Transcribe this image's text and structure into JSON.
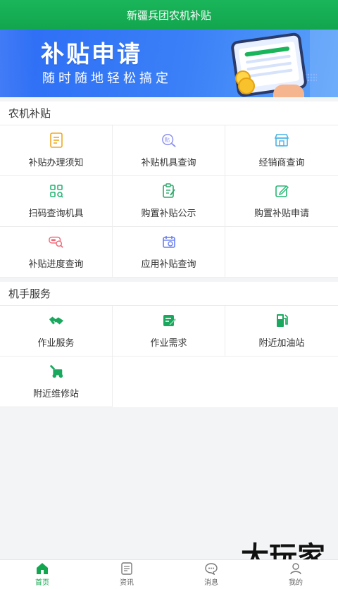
{
  "header": {
    "title": "新疆兵团农机补贴"
  },
  "banner": {
    "title": "补贴申请",
    "subtitle": "随时随地轻松搞定"
  },
  "sections": [
    {
      "title": "农机补贴",
      "items": [
        {
          "label": "补贴办理须知",
          "icon": "document-icon",
          "color": "#f0a825"
        },
        {
          "label": "补贴机具查询",
          "icon": "subsidy-search-icon",
          "color": "#8a8ff0"
        },
        {
          "label": "经销商查询",
          "icon": "store-icon",
          "color": "#47b4e8"
        },
        {
          "label": "扫码查询机具",
          "icon": "scan-grid-icon",
          "color": "#27b574"
        },
        {
          "label": "购置补贴公示",
          "icon": "clipboard-edit-icon",
          "color": "#2aa86a"
        },
        {
          "label": "购置补贴申请",
          "icon": "edit-square-icon",
          "color": "#27b574"
        },
        {
          "label": "补贴进度查询",
          "icon": "progress-search-icon",
          "color": "#f06a7a"
        },
        {
          "label": "应用补贴查询",
          "icon": "calendar-icon",
          "color": "#6a7ff0"
        }
      ]
    },
    {
      "title": "机手服务",
      "items": [
        {
          "label": "作业服务",
          "icon": "handshake-icon",
          "color": "#1aa85e"
        },
        {
          "label": "作业需求",
          "icon": "checklist-icon",
          "color": "#1aa85e"
        },
        {
          "label": "附近加油站",
          "icon": "gas-station-icon",
          "color": "#1aa85e"
        },
        {
          "label": "附近维修站",
          "icon": "tractor-icon",
          "color": "#1aa85e"
        }
      ]
    }
  ],
  "tabbar": [
    {
      "label": "首页",
      "icon": "home-icon",
      "active": true
    },
    {
      "label": "资讯",
      "icon": "news-icon",
      "active": false
    },
    {
      "label": "消息",
      "icon": "message-icon",
      "active": false
    },
    {
      "label": "我的",
      "icon": "profile-icon",
      "active": false
    }
  ],
  "watermark": "大玩家",
  "colors": {
    "primary": "#12a64e",
    "banner": "#2c6cf5"
  }
}
